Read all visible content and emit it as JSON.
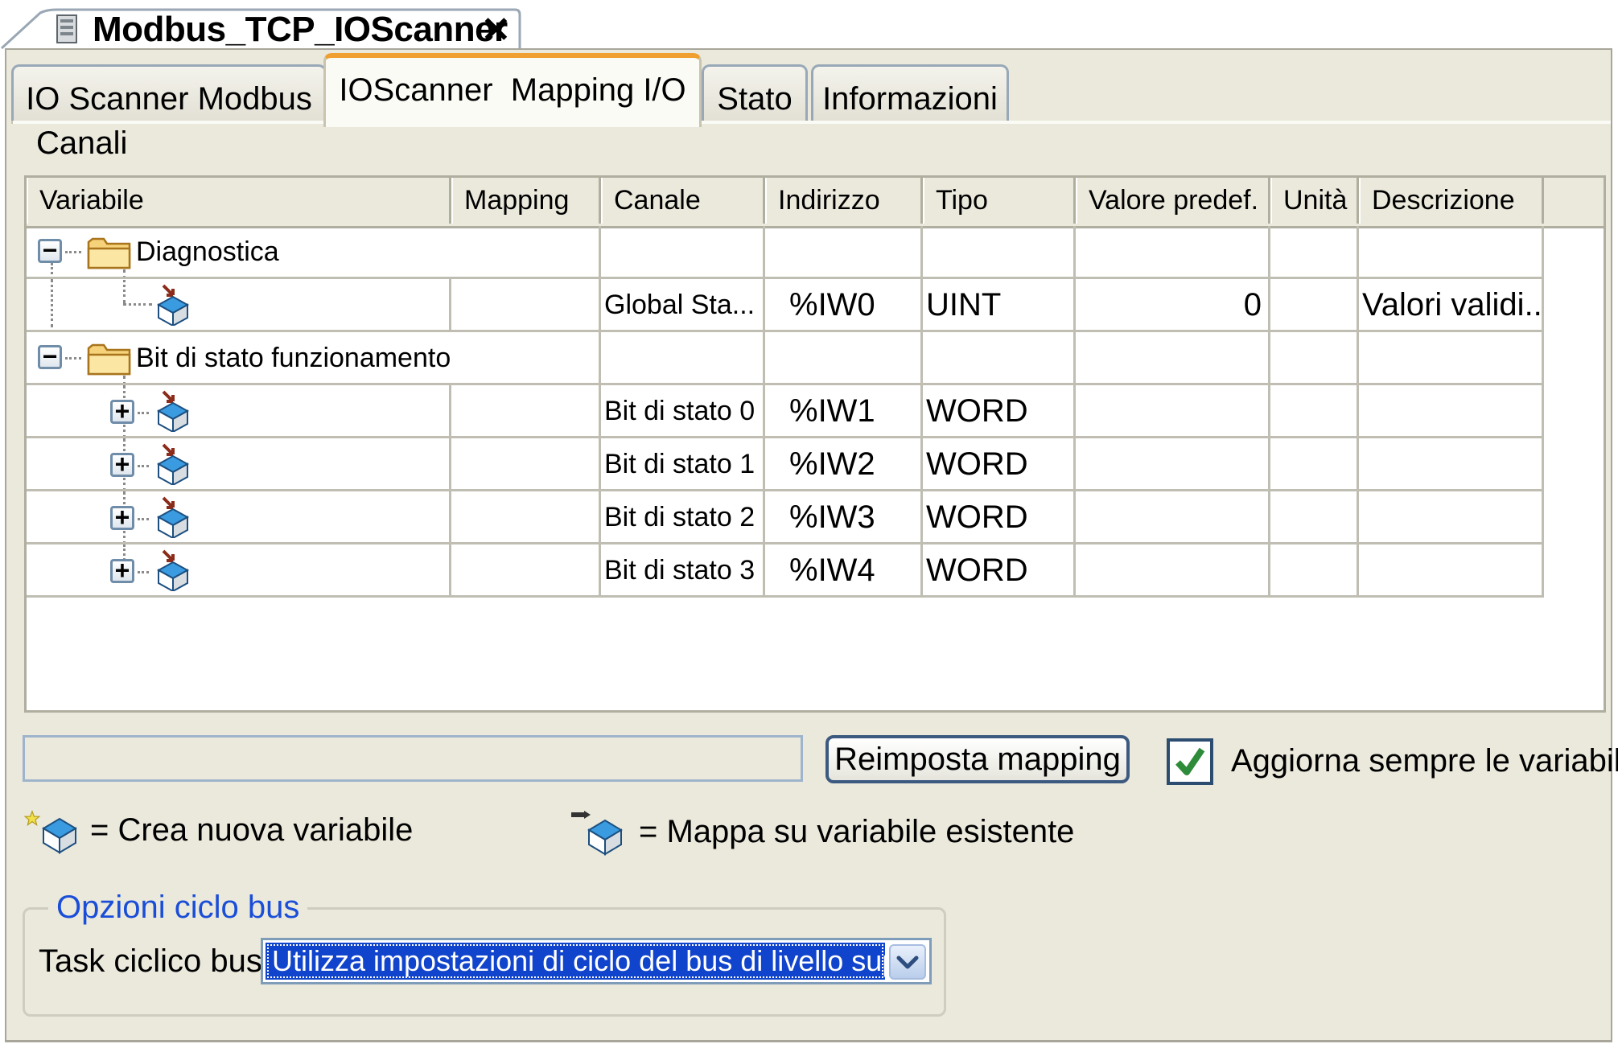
{
  "document_tab": {
    "title": "Modbus_TCP_IOScanner",
    "close_glyph": "✕"
  },
  "tabs": [
    {
      "label": "IO Scanner Modbus",
      "active": false
    },
    {
      "label": "IOScanner  Mapping I/O",
      "active": true
    },
    {
      "label": "Stato",
      "active": false
    },
    {
      "label": "Informazioni",
      "active": false
    }
  ],
  "section_label": "Canali",
  "table": {
    "columns": [
      "Variabile",
      "Mapping",
      "Canale",
      "Indirizzo",
      "Tipo",
      "Valore predef.",
      "Unità",
      "Descrizione"
    ],
    "rows": [
      {
        "kind": "folder",
        "toggle": "−",
        "variable": "Diagnostica",
        "canale": "",
        "indirizzo": "",
        "tipo": "",
        "valore": "",
        "unita": "",
        "descrizione": ""
      },
      {
        "kind": "leaf",
        "toggle": "",
        "variable": "",
        "canale": "Global Sta...",
        "indirizzo": "%IW0",
        "tipo": "UINT",
        "valore": "0",
        "unita": "",
        "descrizione": "Valori validi..."
      },
      {
        "kind": "folder",
        "toggle": "−",
        "variable": "Bit di stato funzionamento",
        "canale": "",
        "indirizzo": "",
        "tipo": "",
        "valore": "",
        "unita": "",
        "descrizione": ""
      },
      {
        "kind": "expandable",
        "toggle": "+",
        "variable": "",
        "canale": "Bit di stato 0",
        "indirizzo": "%IW1",
        "tipo": "WORD",
        "valore": "",
        "unita": "",
        "descrizione": ""
      },
      {
        "kind": "expandable",
        "toggle": "+",
        "variable": "",
        "canale": "Bit di stato 1",
        "indirizzo": "%IW2",
        "tipo": "WORD",
        "valore": "",
        "unita": "",
        "descrizione": ""
      },
      {
        "kind": "expandable",
        "toggle": "+",
        "variable": "",
        "canale": "Bit di stato 2",
        "indirizzo": "%IW3",
        "tipo": "WORD",
        "valore": "",
        "unita": "",
        "descrizione": ""
      },
      {
        "kind": "expandable",
        "toggle": "+",
        "variable": "",
        "canale": "Bit di stato 3",
        "indirizzo": "%IW4",
        "tipo": "WORD",
        "valore": "",
        "unita": "",
        "descrizione": ""
      }
    ]
  },
  "controls": {
    "filter_value": "",
    "reset_button": "Reimposta mapping",
    "always_update_checked": true,
    "always_update_label": "Aggiorna sempre le variabili"
  },
  "legend": {
    "new_variable": "= Crea nuova variabile",
    "existing_variable": "= Mappa su variabile esistente"
  },
  "bus_options": {
    "title": "Opzioni ciclo bus",
    "task_label": "Task ciclico bus",
    "task_value": "Utilizza impostazioni di ciclo del bus di livello superiore"
  },
  "colors": {
    "panel": "#ebe9dc",
    "active_tab_accent": "#f0a030",
    "group_title": "#1a4ed8",
    "selection": "#1144cc",
    "checkmark": "#2e8b3a"
  },
  "icons": {
    "document": "device-document-icon",
    "folder": "folder-icon",
    "channel": "variable-cube-icon",
    "map_arrow": "map-arrow-icon",
    "new_star": "new-star-icon",
    "dropdown": "chevron-down-icon"
  }
}
